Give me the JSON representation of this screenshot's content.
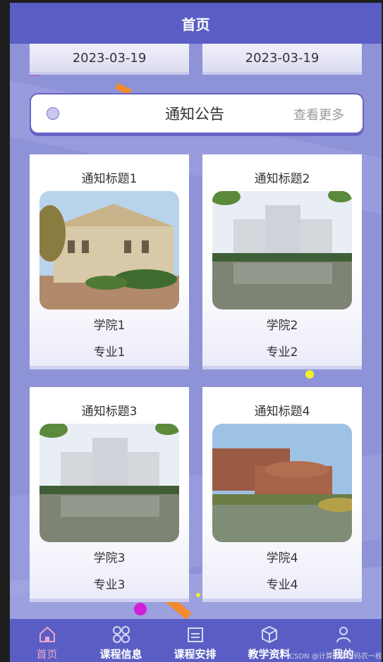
{
  "header": {
    "title": "首页"
  },
  "dates": [
    "2023-03-19",
    "2023-03-19"
  ],
  "notice": {
    "title": "通知公告",
    "more_label": "查看更多"
  },
  "cards": [
    {
      "title": "通知标题1",
      "college": "学院1",
      "major": "专业1"
    },
    {
      "title": "通知标题2",
      "college": "学院2",
      "major": "专业2"
    },
    {
      "title": "通知标题3",
      "college": "学院3",
      "major": "专业3"
    },
    {
      "title": "通知标题4",
      "college": "学院4",
      "major": "专业4"
    }
  ],
  "tabbar": {
    "items": [
      {
        "label": "首页",
        "icon": "home-icon",
        "active": true
      },
      {
        "label": "课程信息",
        "icon": "grid-icon",
        "active": false
      },
      {
        "label": "课程安排",
        "icon": "schedule-icon",
        "active": false
      },
      {
        "label": "教学资料",
        "icon": "box-icon",
        "active": false
      },
      {
        "label": "我的",
        "icon": "user-icon",
        "active": false
      }
    ]
  },
  "watermark": "CSDN @计算机毕设码农一枚",
  "colors": {
    "header": "#5a5ec4",
    "background": "#8e92d6",
    "accent": "#6a62c7",
    "active_tab": "#e8a8c8"
  }
}
